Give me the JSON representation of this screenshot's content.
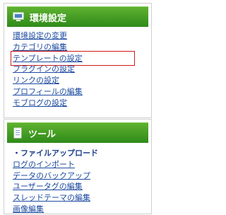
{
  "settings_panel": {
    "title": "環境設定",
    "items": [
      "環境設定の変更",
      "カテゴリの編集",
      "テンプレートの設定",
      "プラグインの設定",
      "リンクの設定",
      "プロフィールの編集",
      "モブログの設定"
    ]
  },
  "tools_panel": {
    "title": "ツール",
    "items": [
      "・ファイルアップロード",
      "ログのインポート",
      "データのバックアップ",
      "ユーザータグの編集",
      "スレッドテーマの編集",
      "画像編集"
    ]
  },
  "colors": {
    "header_green": "#3f9a22",
    "link_blue": "#1c4aa0",
    "highlight_red": "#d11a1a"
  }
}
